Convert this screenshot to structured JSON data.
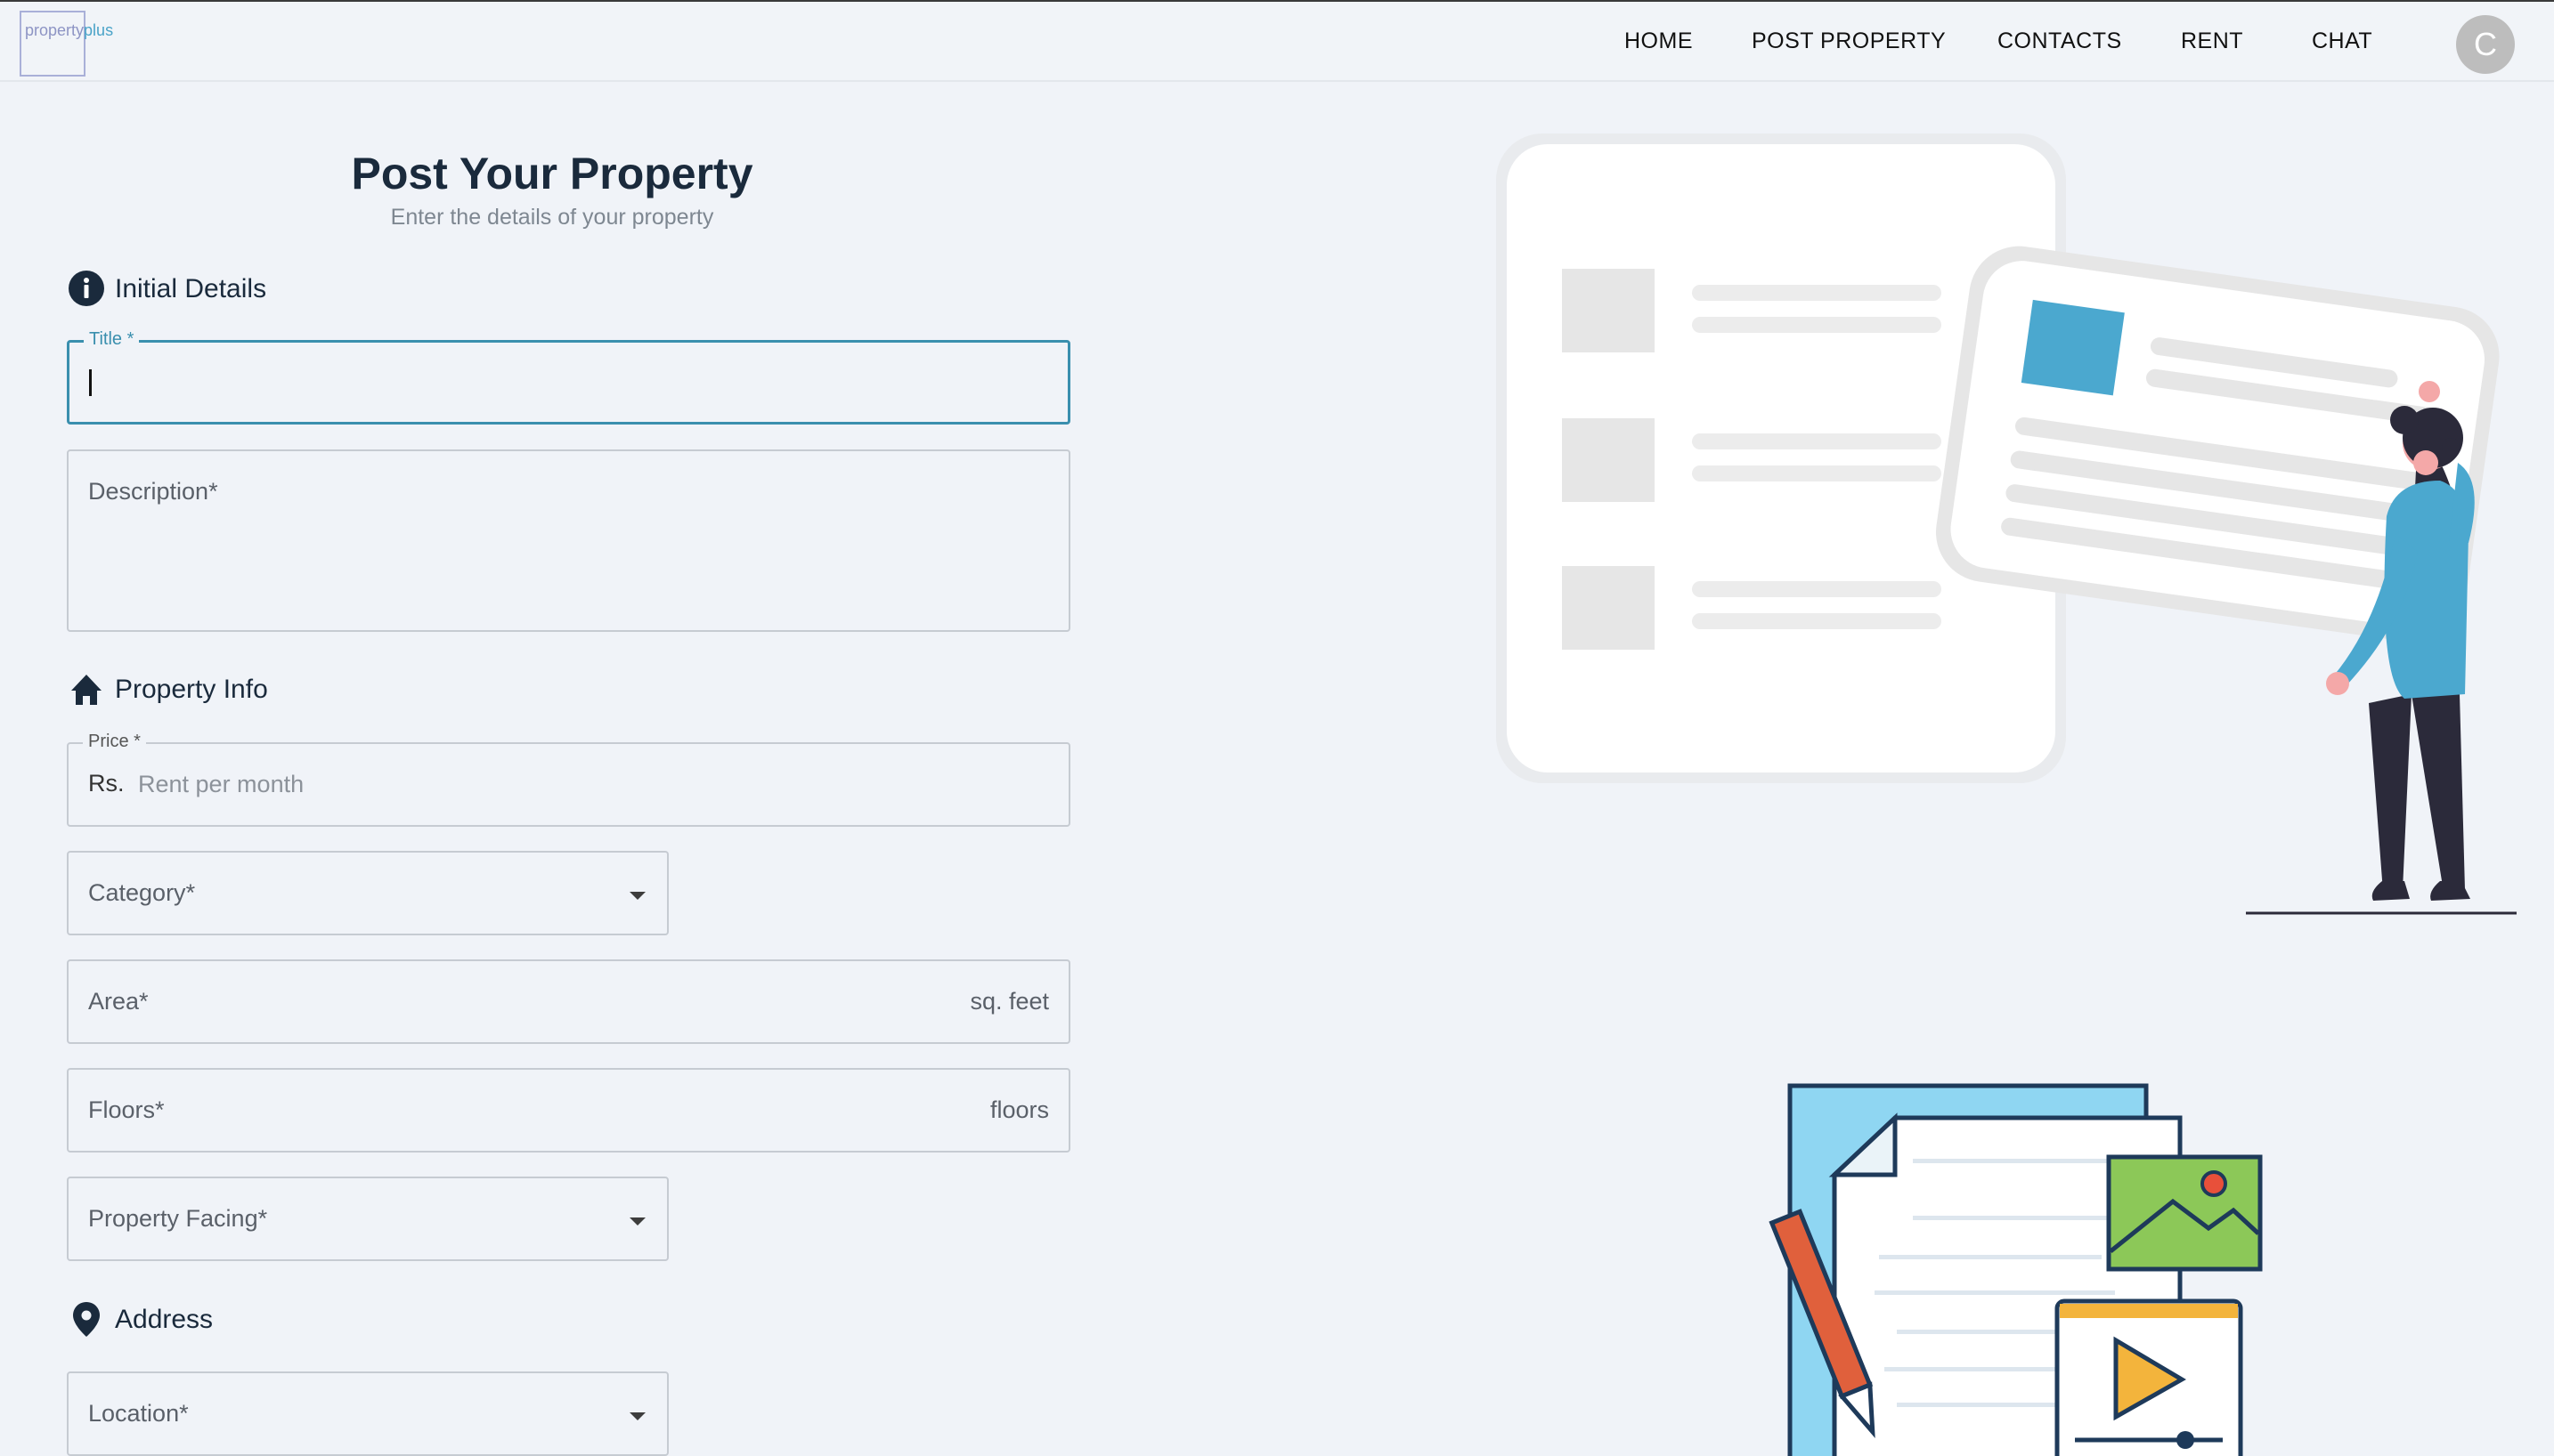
{
  "brand": {
    "logo_part1": "property",
    "logo_part2": "plus"
  },
  "nav": {
    "items": [
      "HOME",
      "POST PROPERTY",
      "CONTACTS",
      "RENT",
      "CHAT"
    ],
    "avatar_initial": "C"
  },
  "header": {
    "title": "Post Your Property",
    "subtitle": "Enter the details of your property"
  },
  "sections": {
    "initial": "Initial Details",
    "property": "Property Info",
    "address": "Address"
  },
  "fields": {
    "title": {
      "label": "Title",
      "required_mark": "*",
      "value": ""
    },
    "description": {
      "label": "Description",
      "required_mark": "*"
    },
    "price": {
      "label": "Price",
      "required_mark": "*",
      "prefix": "Rs.",
      "placeholder": "Rent per month"
    },
    "category": {
      "label": "Category",
      "required_mark": "*"
    },
    "area": {
      "label": "Area",
      "required_mark": "*",
      "suffix": "sq. feet"
    },
    "floors": {
      "label": "Floors",
      "required_mark": "*",
      "suffix": "floors"
    },
    "facing": {
      "label": "Property Facing",
      "required_mark": "*"
    },
    "location": {
      "label": "Location",
      "required_mark": "*"
    }
  },
  "colors": {
    "accent": "#3a8fae",
    "illustration_blue": "#4ba8cf",
    "illustration_dark": "#2b2a3a",
    "background": "#f0f3f8"
  },
  "icons": {
    "initial": "info-circle-icon",
    "property": "home-icon",
    "address": "location-pin-icon"
  }
}
